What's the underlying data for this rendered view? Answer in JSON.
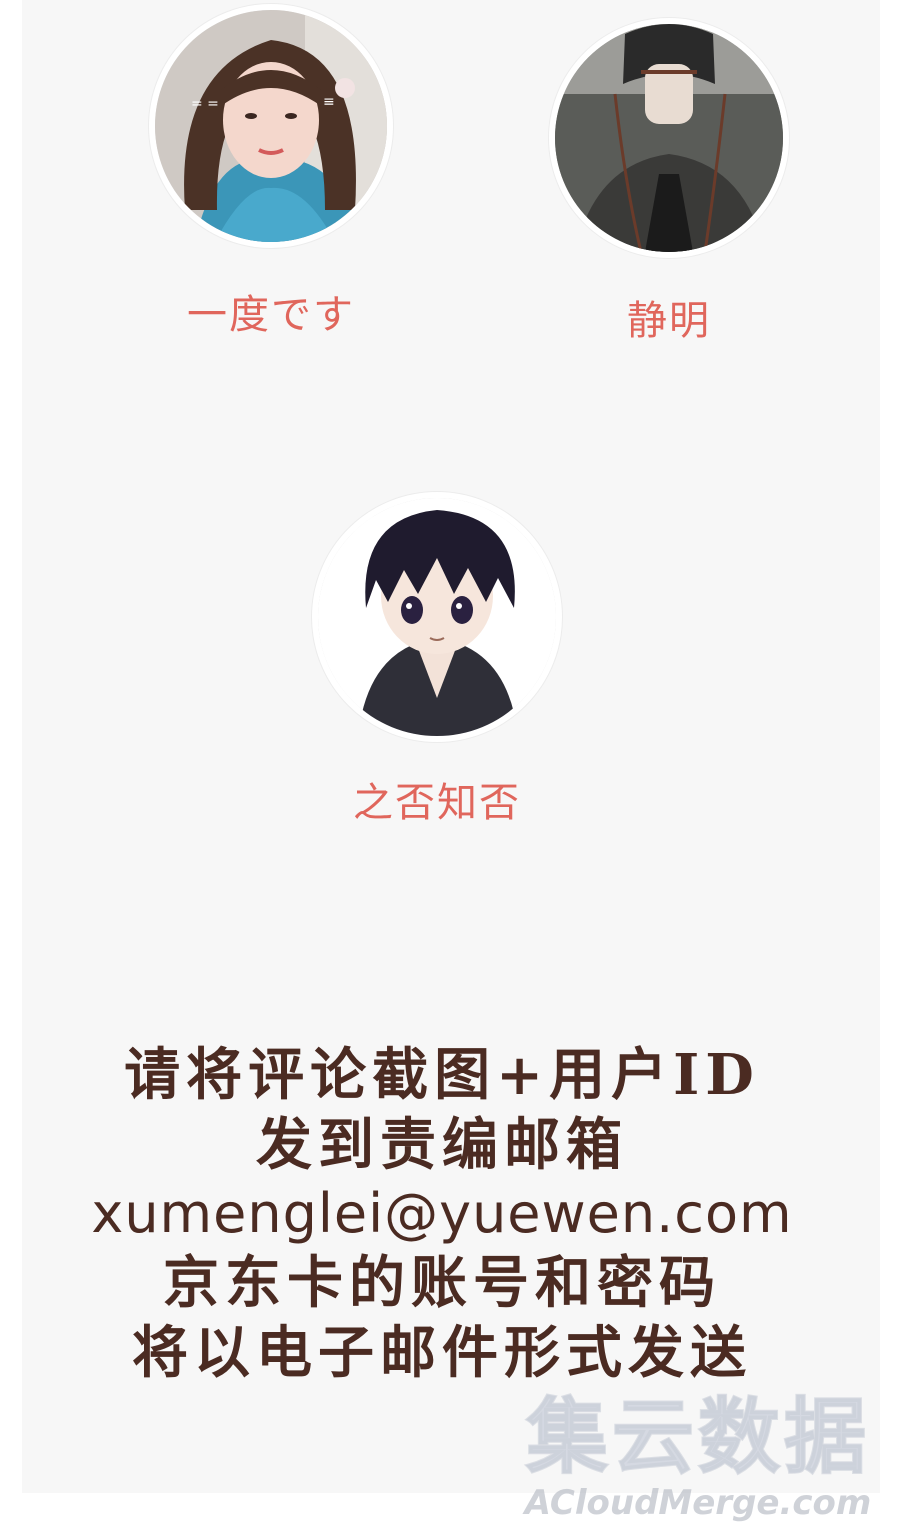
{
  "winners": [
    {
      "name": "一度です",
      "avatar_icon": "girl-photo-avatar"
    },
    {
      "name": "静明",
      "avatar_icon": "illustrated-man-avatar"
    },
    {
      "name": "之否知否",
      "avatar_icon": "anime-boy-avatar"
    }
  ],
  "notice": {
    "line1": "请将评论截图+用户ID",
    "line2": "发到责编邮箱",
    "email": "xumenglei@yuewen.com",
    "line4": "京东卡的账号和密码",
    "line5": "将以电子邮件形式发送"
  },
  "watermark": {
    "cn": "集云数据",
    "en": "ACloudMerge.com"
  },
  "colors": {
    "name_color": "#e0665c",
    "notice_color": "#4b2b22",
    "panel_bg": "#f7f7f7"
  }
}
